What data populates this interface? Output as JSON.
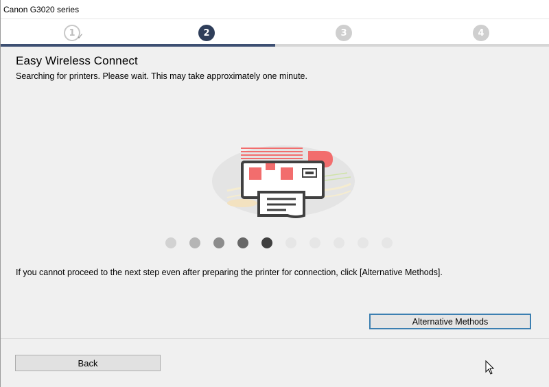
{
  "window": {
    "title": "Canon G3020 series"
  },
  "steps": {
    "items": [
      {
        "label": "1",
        "state": "done"
      },
      {
        "label": "2",
        "state": "active"
      },
      {
        "label": "3",
        "state": "todo"
      },
      {
        "label": "4",
        "state": "todo"
      }
    ],
    "progress_fraction": 0.5
  },
  "main": {
    "heading": "Easy Wireless Connect",
    "subtext": "Searching for printers. Please wait. This may take approximately one minute.",
    "illustration_icon": "printer-wireless-icon",
    "loading_dots": {
      "count": 10,
      "highlighted_index": 4
    },
    "info_text": "If you cannot proceed to the next step even after preparing the printer for connection, click [Alternative Methods].",
    "alt_button_label": "Alternative Methods"
  },
  "footer": {
    "back_label": "Back"
  },
  "colors": {
    "active_step": "#2f3e5a",
    "progress": "#3d4f72",
    "focus_border": "#3c7fb1",
    "printer_accent": "#f26d6d"
  }
}
